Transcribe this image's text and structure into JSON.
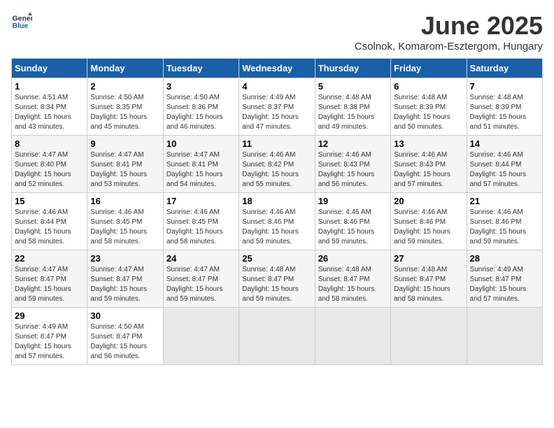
{
  "header": {
    "logo_general": "General",
    "logo_blue": "Blue",
    "month": "June 2025",
    "location": "Csolnok, Komarom-Esztergom, Hungary"
  },
  "weekdays": [
    "Sunday",
    "Monday",
    "Tuesday",
    "Wednesday",
    "Thursday",
    "Friday",
    "Saturday"
  ],
  "weeks": [
    [
      {
        "day": "1",
        "info": "Sunrise: 4:51 AM\nSunset: 8:34 PM\nDaylight: 15 hours\nand 43 minutes."
      },
      {
        "day": "2",
        "info": "Sunrise: 4:50 AM\nSunset: 8:35 PM\nDaylight: 15 hours\nand 45 minutes."
      },
      {
        "day": "3",
        "info": "Sunrise: 4:50 AM\nSunset: 8:36 PM\nDaylight: 15 hours\nand 46 minutes."
      },
      {
        "day": "4",
        "info": "Sunrise: 4:49 AM\nSunset: 8:37 PM\nDaylight: 15 hours\nand 47 minutes."
      },
      {
        "day": "5",
        "info": "Sunrise: 4:48 AM\nSunset: 8:38 PM\nDaylight: 15 hours\nand 49 minutes."
      },
      {
        "day": "6",
        "info": "Sunrise: 4:48 AM\nSunset: 8:39 PM\nDaylight: 15 hours\nand 50 minutes."
      },
      {
        "day": "7",
        "info": "Sunrise: 4:48 AM\nSunset: 8:39 PM\nDaylight: 15 hours\nand 51 minutes."
      }
    ],
    [
      {
        "day": "8",
        "info": "Sunrise: 4:47 AM\nSunset: 8:40 PM\nDaylight: 15 hours\nand 52 minutes."
      },
      {
        "day": "9",
        "info": "Sunrise: 4:47 AM\nSunset: 8:41 PM\nDaylight: 15 hours\nand 53 minutes."
      },
      {
        "day": "10",
        "info": "Sunrise: 4:47 AM\nSunset: 8:41 PM\nDaylight: 15 hours\nand 54 minutes."
      },
      {
        "day": "11",
        "info": "Sunrise: 4:46 AM\nSunset: 8:42 PM\nDaylight: 15 hours\nand 55 minutes."
      },
      {
        "day": "12",
        "info": "Sunrise: 4:46 AM\nSunset: 8:43 PM\nDaylight: 15 hours\nand 56 minutes."
      },
      {
        "day": "13",
        "info": "Sunrise: 4:46 AM\nSunset: 8:43 PM\nDaylight: 15 hours\nand 57 minutes."
      },
      {
        "day": "14",
        "info": "Sunrise: 4:46 AM\nSunset: 8:44 PM\nDaylight: 15 hours\nand 57 minutes."
      }
    ],
    [
      {
        "day": "15",
        "info": "Sunrise: 4:46 AM\nSunset: 8:44 PM\nDaylight: 15 hours\nand 58 minutes."
      },
      {
        "day": "16",
        "info": "Sunrise: 4:46 AM\nSunset: 8:45 PM\nDaylight: 15 hours\nand 58 minutes."
      },
      {
        "day": "17",
        "info": "Sunrise: 4:46 AM\nSunset: 8:45 PM\nDaylight: 15 hours\nand 58 minutes."
      },
      {
        "day": "18",
        "info": "Sunrise: 4:46 AM\nSunset: 8:46 PM\nDaylight: 15 hours\nand 59 minutes."
      },
      {
        "day": "19",
        "info": "Sunrise: 4:46 AM\nSunset: 8:46 PM\nDaylight: 15 hours\nand 59 minutes."
      },
      {
        "day": "20",
        "info": "Sunrise: 4:46 AM\nSunset: 8:46 PM\nDaylight: 15 hours\nand 59 minutes."
      },
      {
        "day": "21",
        "info": "Sunrise: 4:46 AM\nSunset: 8:46 PM\nDaylight: 15 hours\nand 59 minutes."
      }
    ],
    [
      {
        "day": "22",
        "info": "Sunrise: 4:47 AM\nSunset: 8:47 PM\nDaylight: 15 hours\nand 59 minutes."
      },
      {
        "day": "23",
        "info": "Sunrise: 4:47 AM\nSunset: 8:47 PM\nDaylight: 15 hours\nand 59 minutes."
      },
      {
        "day": "24",
        "info": "Sunrise: 4:47 AM\nSunset: 8:47 PM\nDaylight: 15 hours\nand 59 minutes."
      },
      {
        "day": "25",
        "info": "Sunrise: 4:48 AM\nSunset: 8:47 PM\nDaylight: 15 hours\nand 59 minutes."
      },
      {
        "day": "26",
        "info": "Sunrise: 4:48 AM\nSunset: 8:47 PM\nDaylight: 15 hours\nand 58 minutes."
      },
      {
        "day": "27",
        "info": "Sunrise: 4:48 AM\nSunset: 8:47 PM\nDaylight: 15 hours\nand 58 minutes."
      },
      {
        "day": "28",
        "info": "Sunrise: 4:49 AM\nSunset: 8:47 PM\nDaylight: 15 hours\nand 57 minutes."
      }
    ],
    [
      {
        "day": "29",
        "info": "Sunrise: 4:49 AM\nSunset: 8:47 PM\nDaylight: 15 hours\nand 57 minutes."
      },
      {
        "day": "30",
        "info": "Sunrise: 4:50 AM\nSunset: 8:47 PM\nDaylight: 15 hours\nand 56 minutes."
      },
      {
        "day": "",
        "info": ""
      },
      {
        "day": "",
        "info": ""
      },
      {
        "day": "",
        "info": ""
      },
      {
        "day": "",
        "info": ""
      },
      {
        "day": "",
        "info": ""
      }
    ]
  ]
}
